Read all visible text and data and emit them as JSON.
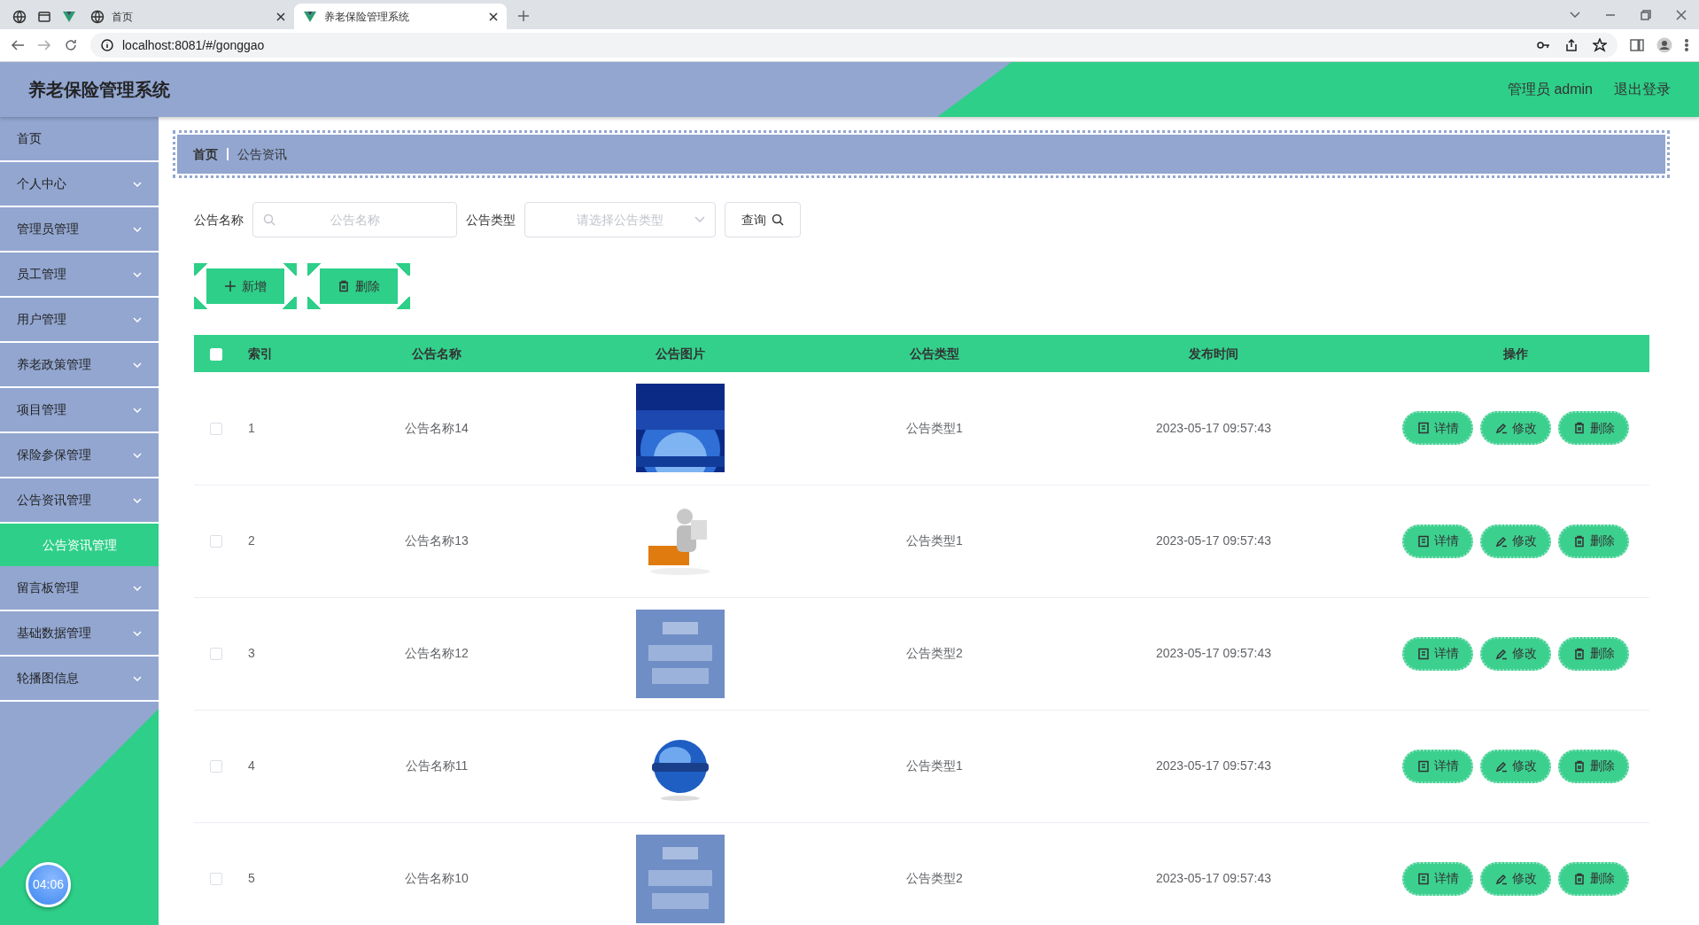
{
  "browser": {
    "tabs": [
      {
        "title": "首页",
        "selected": false
      },
      {
        "title": "养老保险管理系统",
        "selected": true
      }
    ],
    "url": "localhost:8081/#/gonggao"
  },
  "header": {
    "title": "养老保险管理系统",
    "user": "管理员 admin",
    "logout": "退出登录"
  },
  "sidebar": {
    "items": [
      {
        "label": "首页",
        "kind": "link",
        "selected": false
      },
      {
        "label": "个人中心",
        "kind": "menu",
        "selected": false
      },
      {
        "label": "管理员管理",
        "kind": "menu",
        "selected": false
      },
      {
        "label": "员工管理",
        "kind": "menu",
        "selected": false
      },
      {
        "label": "用户管理",
        "kind": "menu",
        "selected": false
      },
      {
        "label": "养老政策管理",
        "kind": "menu",
        "selected": false
      },
      {
        "label": "项目管理",
        "kind": "menu",
        "selected": false
      },
      {
        "label": "保险参保管理",
        "kind": "menu",
        "selected": false
      },
      {
        "label": "公告资讯管理",
        "kind": "menu",
        "selected": false,
        "expanded": true,
        "children": [
          {
            "label": "公告资讯管理",
            "selected": true
          }
        ]
      },
      {
        "label": "留言板管理",
        "kind": "menu",
        "selected": false
      },
      {
        "label": "基础数据管理",
        "kind": "menu",
        "selected": false
      },
      {
        "label": "轮播图信息",
        "kind": "menu",
        "selected": false
      }
    ],
    "timer": "04:06"
  },
  "breadcrumb": [
    "首页",
    "公告资讯"
  ],
  "search": {
    "fields": [
      {
        "label": "公告名称",
        "kind": "input",
        "placeholder": "公告名称"
      },
      {
        "label": "公告类型",
        "kind": "select",
        "placeholder": "请选择公告类型"
      }
    ],
    "query_button": "查询"
  },
  "toolbar": [
    {
      "label": "新增",
      "kind": "add"
    },
    {
      "label": "删除",
      "kind": "delete"
    }
  ],
  "table": {
    "all_selected": false,
    "columns": [
      "索引",
      "公告名称",
      "公告图片",
      "公告类型",
      "发布时间",
      "操作"
    ],
    "rows": [
      {
        "selected": false,
        "index": "1",
        "name": "公告名称14",
        "type": "公告类型1",
        "time": "2023-05-17 09:57:43",
        "actions": [
          {
            "label": "详情",
            "kind": "detail"
          },
          {
            "label": "修改",
            "kind": "edit"
          },
          {
            "label": "删除",
            "kind": "delete"
          }
        ]
      },
      {
        "selected": false,
        "index": "2",
        "name": "公告名称13",
        "type": "公告类型1",
        "time": "2023-05-17 09:57:43",
        "actions": [
          {
            "label": "详情",
            "kind": "detail"
          },
          {
            "label": "修改",
            "kind": "edit"
          },
          {
            "label": "删除",
            "kind": "delete"
          }
        ]
      },
      {
        "selected": false,
        "index": "3",
        "name": "公告名称12",
        "type": "公告类型2",
        "time": "2023-05-17 09:57:43",
        "actions": [
          {
            "label": "详情",
            "kind": "detail"
          },
          {
            "label": "修改",
            "kind": "edit"
          },
          {
            "label": "删除",
            "kind": "delete"
          }
        ]
      },
      {
        "selected": false,
        "index": "4",
        "name": "公告名称11",
        "type": "公告类型1",
        "time": "2023-05-17 09:57:43",
        "actions": [
          {
            "label": "详情",
            "kind": "detail"
          },
          {
            "label": "修改",
            "kind": "edit"
          },
          {
            "label": "删除",
            "kind": "delete"
          }
        ]
      },
      {
        "selected": false,
        "index": "5",
        "name": "公告名称10",
        "type": "公告类型2",
        "time": "2023-05-17 09:57:43",
        "actions": [
          {
            "label": "详情",
            "kind": "detail"
          },
          {
            "label": "修改",
            "kind": "edit"
          },
          {
            "label": "删除",
            "kind": "delete"
          }
        ]
      }
    ]
  }
}
